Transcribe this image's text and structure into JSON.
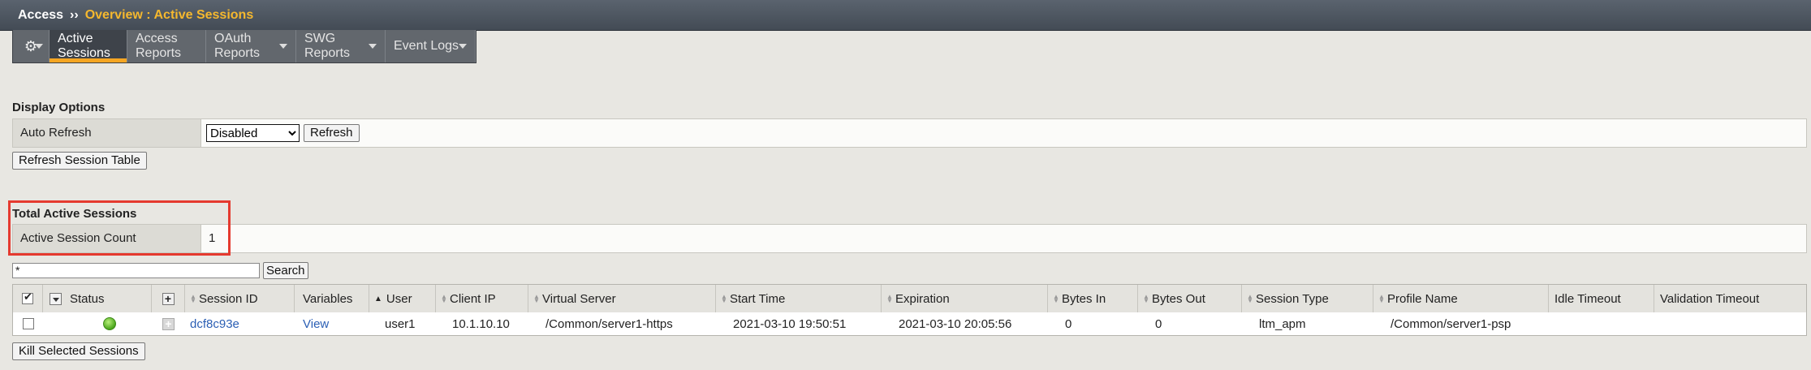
{
  "breadcrumb": {
    "root": "Access",
    "separator": "››",
    "current": "Overview : Active Sessions"
  },
  "menu": {
    "items": [
      {
        "label": "Active Sessions",
        "active": true,
        "dropdown": false
      },
      {
        "label": "Access Reports",
        "active": false,
        "dropdown": false
      },
      {
        "label": "OAuth Reports",
        "active": false,
        "dropdown": true
      },
      {
        "label": "SWG Reports",
        "active": false,
        "dropdown": true
      },
      {
        "label": "Event Logs",
        "active": false,
        "dropdown": true
      }
    ],
    "gear_icon": "gear-icon"
  },
  "display_options": {
    "title": "Display Options",
    "auto_refresh_label": "Auto Refresh",
    "auto_refresh_value": "Disabled",
    "refresh_button": "Refresh",
    "refresh_table_button": "Refresh Session Table"
  },
  "total": {
    "title": "Total Active Sessions",
    "count_label": "Active Session Count",
    "count_value": "1"
  },
  "search": {
    "value": "*",
    "button": "Search"
  },
  "table": {
    "headers": {
      "status": "Status",
      "session_id": "Session ID",
      "variables": "Variables",
      "user": "User",
      "client_ip": "Client IP",
      "virtual_server": "Virtual Server",
      "start_time": "Start Time",
      "expiration": "Expiration",
      "bytes_in": "Bytes In",
      "bytes_out": "Bytes Out",
      "session_type": "Session Type",
      "profile_name": "Profile Name",
      "idle_timeout": "Idle Timeout",
      "validation_timeout": "Validation Timeout"
    },
    "rows": [
      {
        "status_color": "#4aa51b",
        "session_id": "dcf8c93e",
        "variables": "View",
        "user": "user1",
        "client_ip": "10.1.10.10",
        "virtual_server": "/Common/server1-https",
        "start_time": "2021-03-10 19:50:51",
        "expiration": "2021-03-10 20:05:56",
        "bytes_in": "0",
        "bytes_out": "0",
        "session_type": "ltm_apm",
        "profile_name": "/Common/server1-psp",
        "idle_timeout": "",
        "validation_timeout": ""
      }
    ]
  },
  "kill_button": "Kill Selected Sessions",
  "colors": {
    "accent": "#f5a623",
    "breadcrumb_current": "#f5b82e",
    "highlight": "#e53a2f",
    "link": "#2b5fb4"
  }
}
